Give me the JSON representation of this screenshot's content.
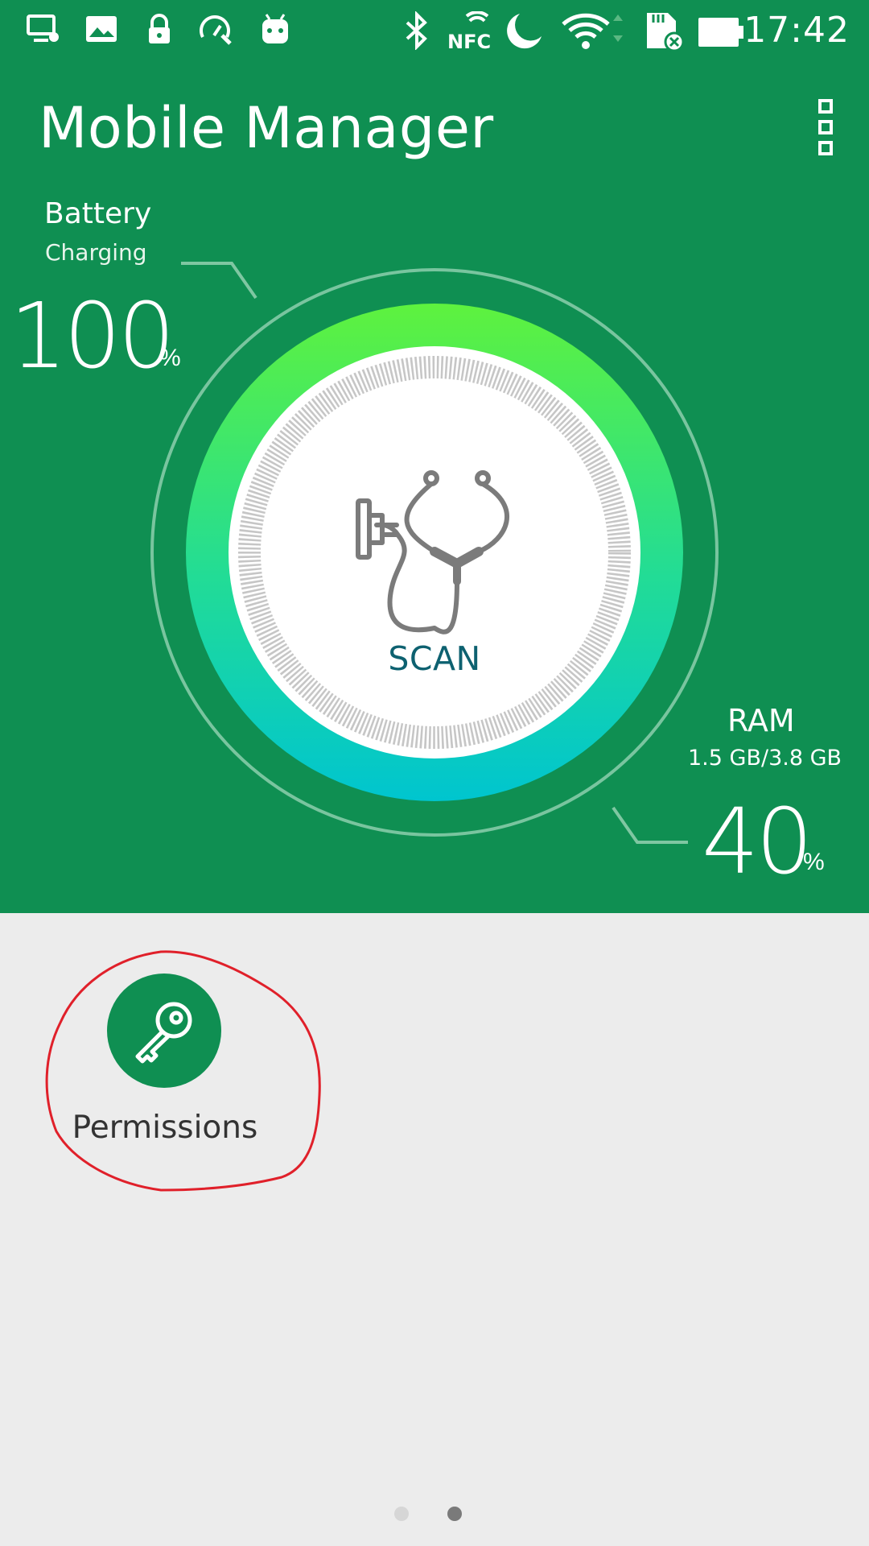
{
  "status_bar": {
    "time": "17:42",
    "icons": [
      "screen-cast-icon",
      "gallery-icon",
      "lock-icon",
      "speed-tool-icon",
      "android-icon",
      "bluetooth-icon",
      "nfc-icon",
      "do-not-disturb-moon-icon",
      "wifi-icon",
      "sd-card-error-icon",
      "battery-icon"
    ],
    "nfc_text": "NFC"
  },
  "app_bar": {
    "title": "Mobile Manager",
    "menu_icon": "more-vert-icon"
  },
  "battery": {
    "label": "Battery",
    "status": "Charging",
    "value": "100",
    "unit": "%"
  },
  "ram": {
    "label": "RAM",
    "usage": "1.5 GB/3.8 GB",
    "value": "40",
    "unit": "%"
  },
  "scan": {
    "label": "SCAN",
    "icon": "stethoscope-icon"
  },
  "tiles": [
    {
      "label": "Permissions",
      "icon": "key-icon"
    }
  ],
  "pager": {
    "pages": 2,
    "current": 2
  },
  "colors": {
    "header_green": "#0f8f52",
    "gauge_top": "#5ef23e",
    "gauge_bottom": "#00c5cf",
    "scan_text": "#0d6170",
    "background": "#ececec",
    "annotation_red": "#e0202a"
  }
}
